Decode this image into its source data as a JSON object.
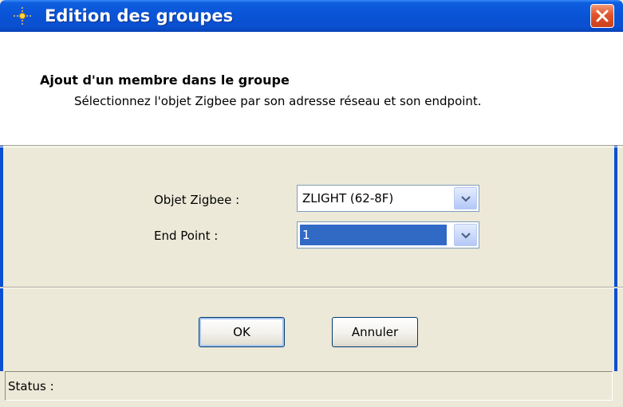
{
  "window": {
    "title": "Edition des groupes",
    "accent_color": "#0a55d8",
    "close_icon": "close-icon"
  },
  "header": {
    "title": "Ajout d'un membre dans le groupe",
    "subtitle": "Sélectionnez l'objet Zigbee par son adresse réseau et son endpoint."
  },
  "form": {
    "objet_label": "Objet Zigbee :",
    "objet_value": "ZLIGHT (62-8F)",
    "endpoint_label": "End Point :",
    "endpoint_value": "1"
  },
  "buttons": {
    "ok_label": "OK",
    "cancel_label": "Annuler"
  },
  "statusbar": {
    "text": "Status :"
  }
}
